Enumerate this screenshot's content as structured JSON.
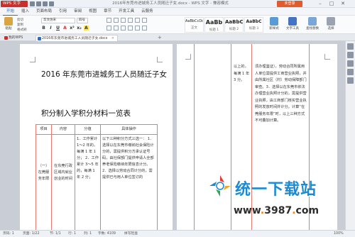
{
  "titlebar": {
    "app_label": "WPS 文字",
    "window_title": "2016年东莞市进城务工人员随迁子女.docx - WPS 文字 - 兼容模式",
    "login_label": "未登录",
    "minimize": "–",
    "maximize": "□",
    "close": "✕"
  },
  "menu": [
    "开始",
    "插入",
    "页面布局",
    "引用",
    "审阅",
    "视图",
    "章节",
    "开发工具",
    "云服务"
  ],
  "ribbon": {
    "paste": "粘贴",
    "cut": "剪切",
    "copy": "复制",
    "format_painter": "格式刷",
    "font_name": "华文仿宋",
    "font_size": "四号",
    "format_buttons": [
      "B",
      "I",
      "U",
      "A",
      "x²",
      "x₂",
      "A"
    ],
    "styles": [
      {
        "sample": "AaBbCcDd",
        "label": "正文"
      },
      {
        "sample": "AaBb",
        "label": "标题 1"
      },
      {
        "sample": "AaBbC",
        "label": "标题 2"
      },
      {
        "sample": "AaBbC",
        "label": "标题 3"
      }
    ],
    "new_style": "新样式",
    "text_tools": "文字工具",
    "find_replace": "查找替换",
    "select": "选择"
  },
  "tabs": {
    "tab1": "我的WPS",
    "tab2": "2016年东莞市进城务工人员随迁子女.docx",
    "plus": "+"
  },
  "doc": {
    "title": "2016 年东莞市进城务工人员随迁子女",
    "subtitle": "积分制入学积分材料一览表",
    "headers": [
      "项目",
      "内容",
      "分值",
      "具体操作"
    ],
    "row": {
      "project": "（一）在莞服务年限",
      "content": "在东莞行政区域内就业创业的时间",
      "score": "1．工作累计 1～2 年的，每满 1 年 1 分； 2．工作累计 3～5 年的，每满 1 年 2 分；",
      "operation": "以下三种积分方式三选一： 1．选择以在东莞市缴纳社会保险计分的，需提供积分方承认证号码，由社保部门提供申请人全部养老保险缴纳年限信息计分。 2．选择以劳动合同计分的，需提供已与用人单位签订的"
    },
    "page2": {
      "score_cont": "以上的，每满 1 年 3 分。",
      "op_cont": "须办理鉴证），劳动合同所属用人单位需提供工商营业执照，并由所属社区（村）劳动保障部门审查。3．选择以在东莞市依法办理营业执照计分的，需提供营业执照，由工商部门核实营业执照的发放时间并计分。计算“在莞服务年限”时，以上三种方式不可叠加计算。"
    }
  },
  "watermark": {
    "brand": "统一下载站",
    "url_prefix": "www",
    "url_dot1": ".",
    "url_mid": "3987",
    "url_dot2": ".",
    "url_suffix": "com"
  },
  "status": {
    "page_num": "页码: 1",
    "page_of": "页面: 1/22",
    "section": "节: 1/1",
    "row": "行: 1",
    "col": "列: 1",
    "words": "字数: 4109",
    "spell": "拼写检查",
    "zoom": "100%"
  }
}
